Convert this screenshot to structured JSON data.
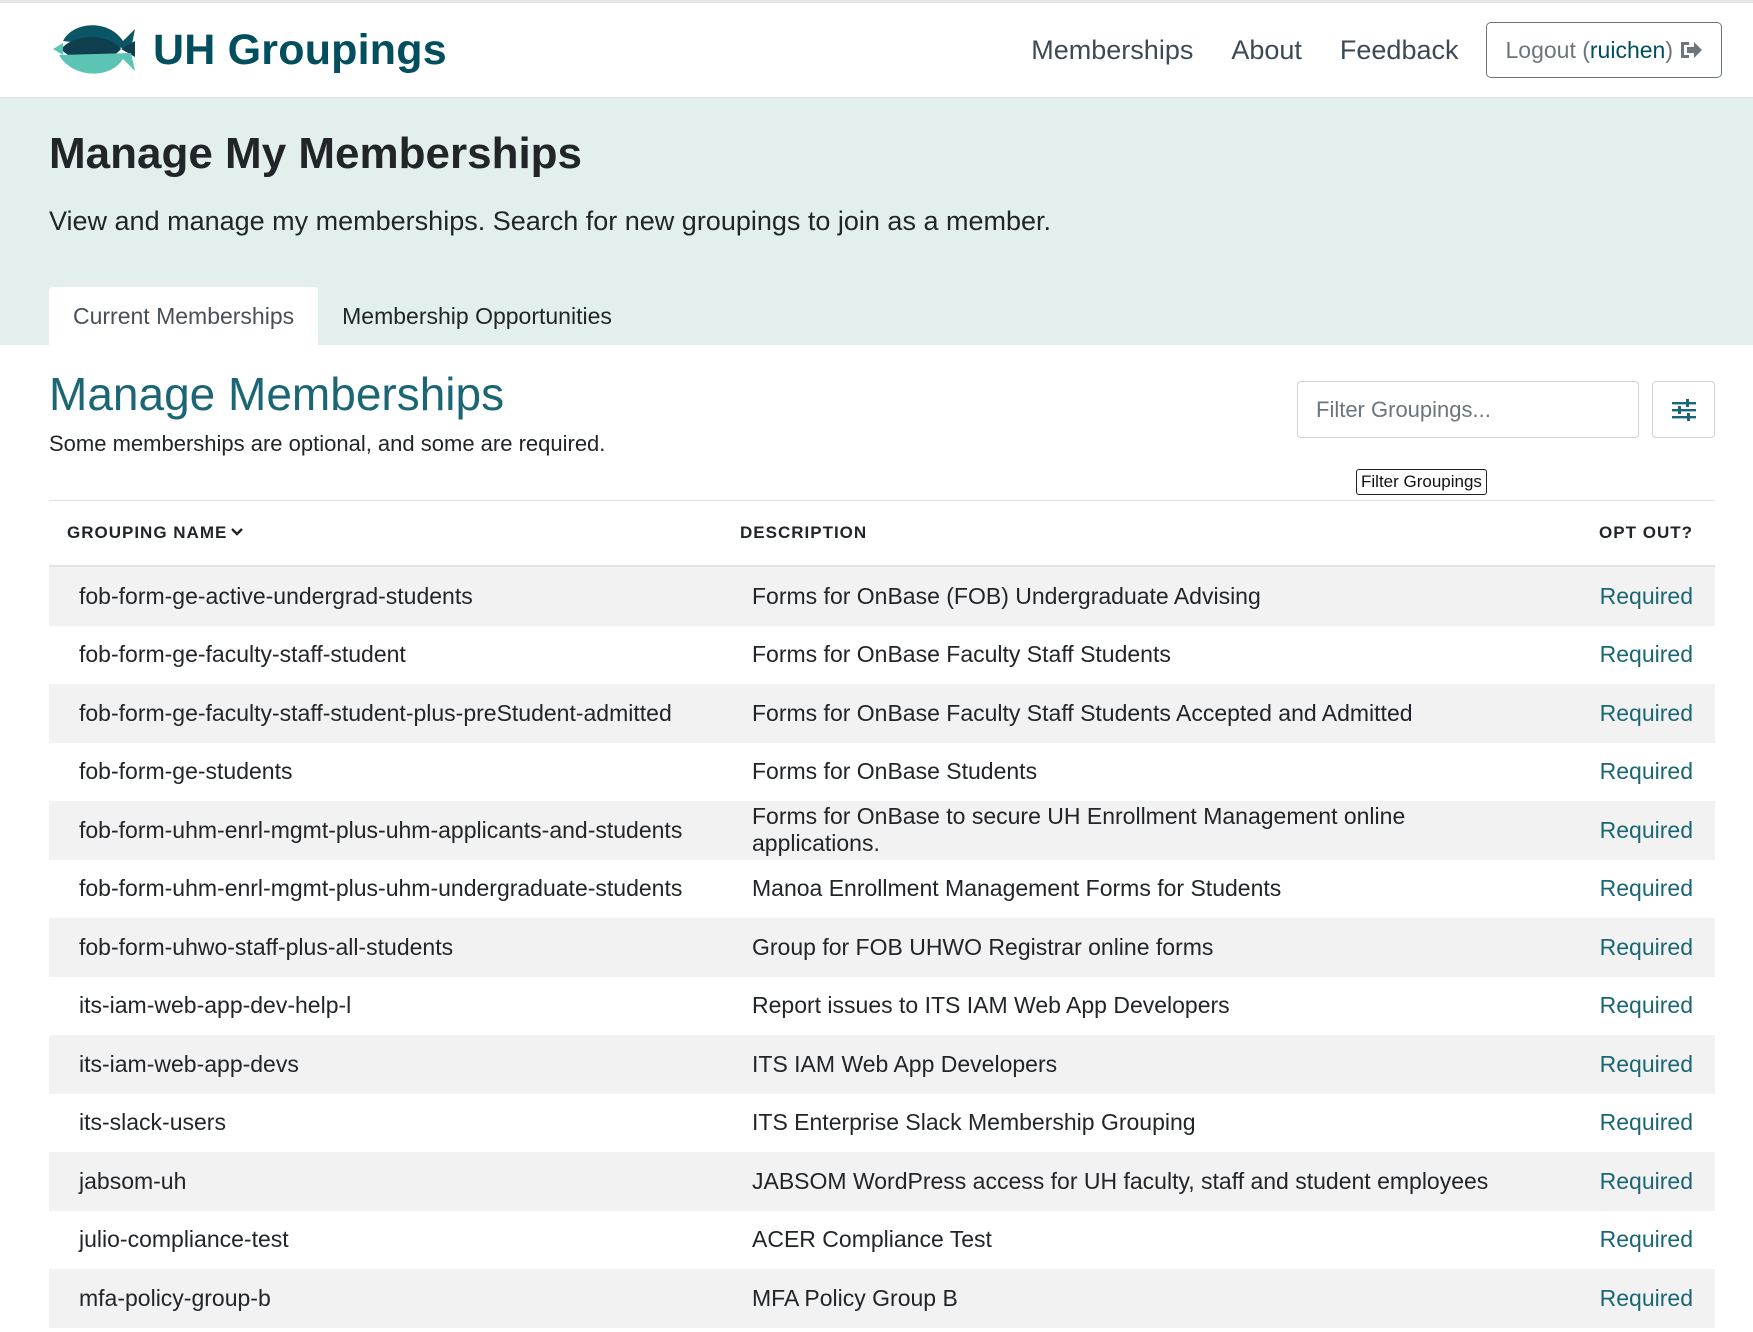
{
  "brand": {
    "name": "UH Groupings",
    "logo_icon": "fish-logo-icon"
  },
  "nav": {
    "links": [
      "Memberships",
      "About",
      "Feedback"
    ],
    "logout_prefix": "Logout (",
    "username": "ruichen",
    "logout_suffix": ")",
    "logout_icon": "sign-out-icon"
  },
  "hero": {
    "title": "Manage My Memberships",
    "subtitle": "View and manage my memberships. Search for new groupings to join as a member.",
    "tabs": [
      {
        "label": "Current Memberships",
        "active": true
      },
      {
        "label": "Membership Opportunities",
        "active": false
      }
    ]
  },
  "section": {
    "title": "Manage Memberships",
    "subtitle": "Some memberships are optional, and some are required.",
    "filter_placeholder": "Filter Groupings...",
    "filter_tooltip": "Filter Groupings",
    "filter_icon": "sliders-icon"
  },
  "table": {
    "headers": {
      "name": "GROUPING NAME",
      "description": "DESCRIPTION",
      "opt_out": "OPT OUT?"
    },
    "sort_icon": "chevron-down-icon",
    "rows": [
      {
        "name": "fob-form-ge-active-undergrad-students",
        "description": "Forms for OnBase (FOB) Undergraduate Advising",
        "opt_out": "Required"
      },
      {
        "name": "fob-form-ge-faculty-staff-student",
        "description": "Forms for OnBase Faculty Staff Students",
        "opt_out": "Required"
      },
      {
        "name": "fob-form-ge-faculty-staff-student-plus-preStudent-admitted",
        "description": "Forms for OnBase Faculty Staff Students Accepted and Admitted",
        "opt_out": "Required"
      },
      {
        "name": "fob-form-ge-students",
        "description": "Forms for OnBase Students",
        "opt_out": "Required"
      },
      {
        "name": "fob-form-uhm-enrl-mgmt-plus-uhm-applicants-and-students",
        "description": "Forms for OnBase to secure UH Enrollment Management online applications.",
        "opt_out": "Required"
      },
      {
        "name": "fob-form-uhm-enrl-mgmt-plus-uhm-undergraduate-students",
        "description": "Manoa Enrollment Management Forms for Students",
        "opt_out": "Required"
      },
      {
        "name": "fob-form-uhwo-staff-plus-all-students",
        "description": "Group for FOB UHWO Registrar online forms",
        "opt_out": "Required"
      },
      {
        "name": "its-iam-web-app-dev-help-l",
        "description": "Report issues to ITS IAM Web App Developers",
        "opt_out": "Required"
      },
      {
        "name": "its-iam-web-app-devs",
        "description": "ITS IAM Web App Developers",
        "opt_out": "Required"
      },
      {
        "name": "its-slack-users",
        "description": "ITS Enterprise Slack Membership Grouping",
        "opt_out": "Required"
      },
      {
        "name": "jabsom-uh",
        "description": "JABSOM WordPress access for UH faculty, staff and student employees",
        "opt_out": "Required"
      },
      {
        "name": "julio-compliance-test",
        "description": "ACER Compliance Test",
        "opt_out": "Required"
      },
      {
        "name": "mfa-policy-group-b",
        "description": "MFA Policy Group B",
        "opt_out": "Required"
      }
    ]
  },
  "colors": {
    "brand": "#004e5e",
    "accent_teal": "#1b6675",
    "hero_bg": "#e3efed",
    "logo_light": "#5cc4b4",
    "stripe": "#f2f2f2"
  }
}
